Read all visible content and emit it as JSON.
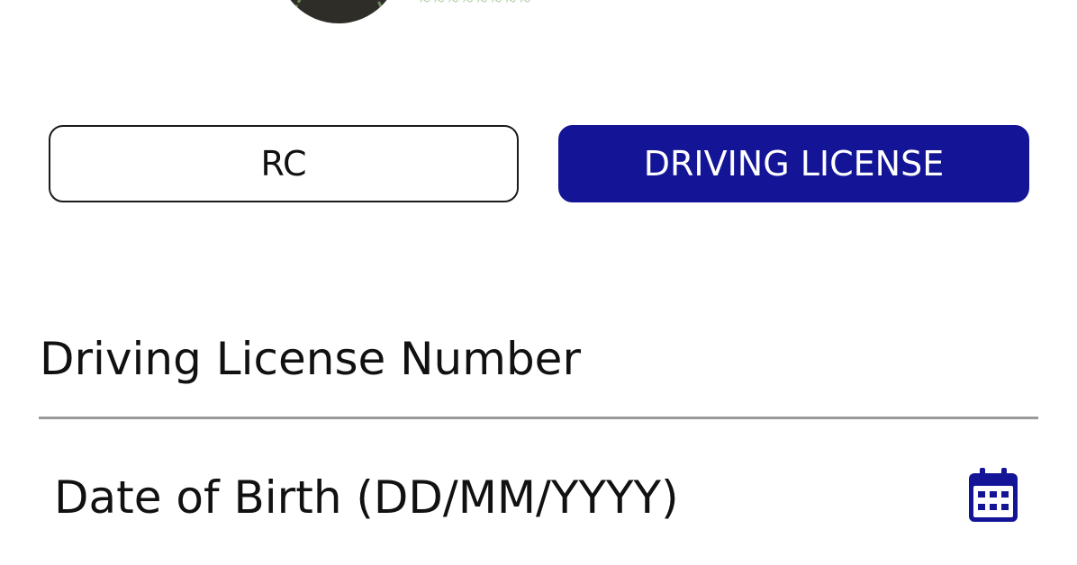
{
  "tabs": {
    "rc_label": "RC",
    "driving_license_label": "DRIVING LICENSE",
    "selected": "DRIVING LICENSE"
  },
  "form": {
    "license_number_placeholder": "Driving License Number",
    "dob_placeholder": "Date of Birth (DD/MM/YYYY)"
  },
  "icons": {
    "calendar": "calendar-icon"
  },
  "colors": {
    "accent": "#141497",
    "underline": "#9a9a9a",
    "text": "#111111"
  }
}
